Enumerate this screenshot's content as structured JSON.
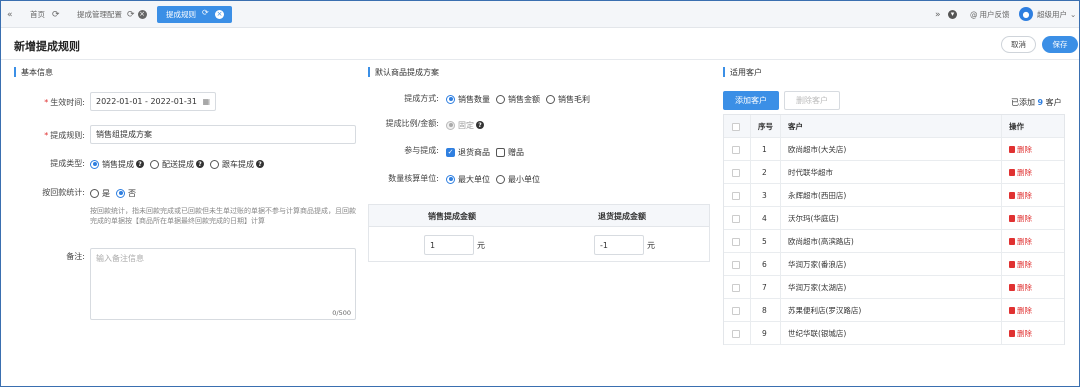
{
  "topbar": {
    "collapse_icon": "double-left-chevron",
    "tabs": [
      {
        "label": "首页"
      },
      {
        "label": "提成管理配置"
      },
      {
        "label": "提成规则"
      }
    ],
    "user": {
      "feedback": "用户反馈",
      "name": "超级用户"
    }
  },
  "header": {
    "title": "新增提成规则",
    "cancel": "取消",
    "save": "保存"
  },
  "basic": {
    "title": "基本信息",
    "effective_label": "生效时间:",
    "effective_value": "2022-01-01 - 2022-01-31",
    "rule_label": "提成规则:",
    "rule_value": "销售组提成方案",
    "type_label": "提成类型:",
    "type_options": [
      "销售提成",
      "配送提成",
      "跟车提成"
    ],
    "type_selected": 0,
    "collection_label": "按回款统计:",
    "collection_options": [
      "是",
      "否"
    ],
    "collection_selected": 1,
    "hint": "按回款统计，指未回款完成或已回款但未生单过账的单据不参与计算商品提成，且回款完成的单据按【商品所在单据最终回款完成的日期】计算",
    "note_label": "备注:",
    "note_placeholder": "输入备注信息",
    "note_counter": "0/500"
  },
  "default_plan": {
    "title": "默认商品提成方案",
    "method_label": "提成方式:",
    "method_options": [
      "销售数量",
      "销售金额",
      "销售毛利"
    ],
    "method_selected": 0,
    "ratio_label": "提成比例/金额:",
    "ratio_option": "固定",
    "participate_label": "参与提成:",
    "participate_options": [
      "退货商品",
      "赠品"
    ],
    "participate_checked": [
      true,
      false
    ],
    "unit_label": "数量核算单位:",
    "unit_options": [
      "最大单位",
      "最小单位"
    ],
    "unit_selected": 0,
    "table": {
      "sale_header": "销售提成金额",
      "return_header": "退货提成金额",
      "sale_value": "1",
      "return_value": "-1",
      "unit": "元"
    }
  },
  "customers": {
    "title": "适用客户",
    "add_button": "添加客户",
    "delete_button": "删除客户",
    "added_prefix": "已添加",
    "added_count": "9",
    "added_suffix": "客户",
    "headers": {
      "no": "序号",
      "customer": "客户",
      "action": "操作"
    },
    "delete_label": "删除",
    "rows": [
      {
        "no": "1",
        "name": "欧尚超市(大关店)"
      },
      {
        "no": "2",
        "name": "时代联华超市"
      },
      {
        "no": "3",
        "name": "永辉超市(西田店)"
      },
      {
        "no": "4",
        "name": "沃尔玛(华庭店)"
      },
      {
        "no": "5",
        "name": "欧尚超市(高滨路店)"
      },
      {
        "no": "6",
        "name": "华润万家(番浪店)"
      },
      {
        "no": "7",
        "name": "华润万家(太湖店)"
      },
      {
        "no": "8",
        "name": "苏果便利店(罗汉路店)"
      },
      {
        "no": "9",
        "name": "世纪华联(银城店)"
      }
    ]
  },
  "colors": {
    "primary": "#3b8fe6",
    "danger": "#e03131",
    "border": "#d7dbe0"
  }
}
